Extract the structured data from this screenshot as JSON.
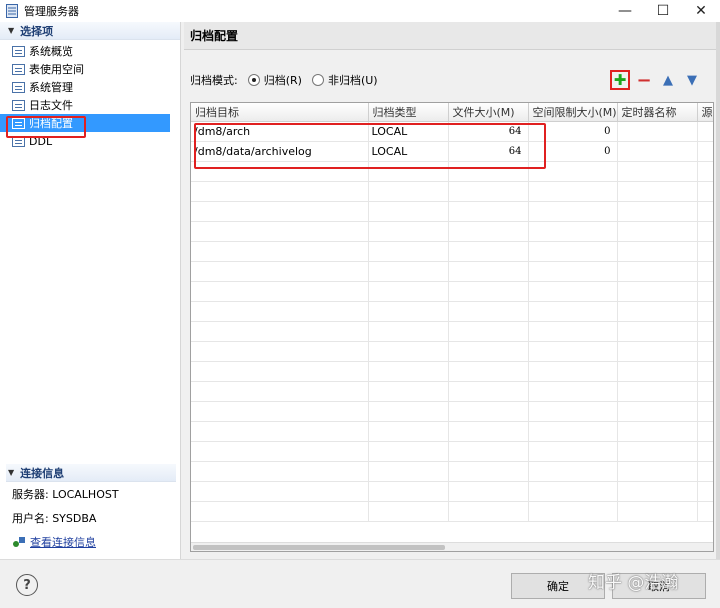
{
  "window": {
    "title": "管理服务器",
    "minimize": "—",
    "maximize": "☐",
    "close": "✕"
  },
  "sidebar": {
    "header": "选择项",
    "items": [
      {
        "label": "系统概览"
      },
      {
        "label": "表使用空间"
      },
      {
        "label": "系统管理"
      },
      {
        "label": "日志文件"
      },
      {
        "label": "归档配置"
      },
      {
        "label": "DDL"
      }
    ],
    "selected_index": 4,
    "conn_header": "连接信息",
    "server_label": "服务器: LOCALHOST",
    "user_label": "用户名: SYSDBA",
    "view_conn_link": "查看连接信息"
  },
  "main": {
    "title": "归档配置",
    "mode_label": "归档模式:",
    "mode_archive": "归档(R)",
    "mode_noarchive": "非归档(U)",
    "selected_mode": "archive",
    "columns": [
      "归档目标",
      "归档类型",
      "文件大小(M)",
      "空间限制大小(M)",
      "定时器名称",
      "源"
    ],
    "rows": [
      [
        "/dm8/arch",
        "LOCAL",
        "64",
        "0",
        ""
      ],
      [
        "/dm8/data/archivelog",
        "LOCAL",
        "64",
        "0",
        ""
      ]
    ]
  },
  "toolbar": {
    "add_icon": "plus-icon",
    "remove_icon": "minus-icon",
    "up_icon": "arrow-up-icon",
    "down_icon": "arrow-down-icon",
    "add_color": "#1da51d",
    "remove_color": "#d03030"
  },
  "footer": {
    "help": "?",
    "ok": "确定",
    "cancel": "取消",
    "watermark": "知乎 @浩瀚"
  }
}
